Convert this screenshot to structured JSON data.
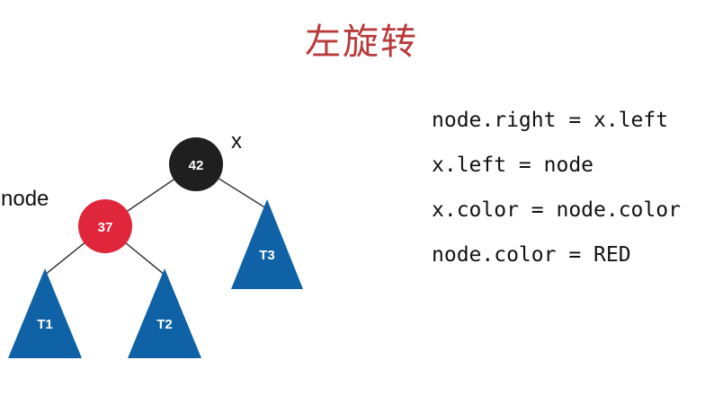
{
  "title": "左旋转",
  "labels": {
    "x": "x",
    "node": "node"
  },
  "colors": {
    "title": "#b83a3a",
    "black_node": "#1f1f1f",
    "red_node": "#e0263a",
    "subtree": "#0f62a5",
    "edge": "#3a3a3a"
  },
  "nodes": {
    "x_node": {
      "value": "42",
      "color": "black"
    },
    "node_node": {
      "value": "37",
      "color": "red"
    }
  },
  "subtrees": {
    "t1": "T1",
    "t2": "T2",
    "t3": "T3"
  },
  "code_lines": [
    "node.right = x.left",
    "x.left = node",
    "x.color = node.color",
    "node.color = RED"
  ]
}
